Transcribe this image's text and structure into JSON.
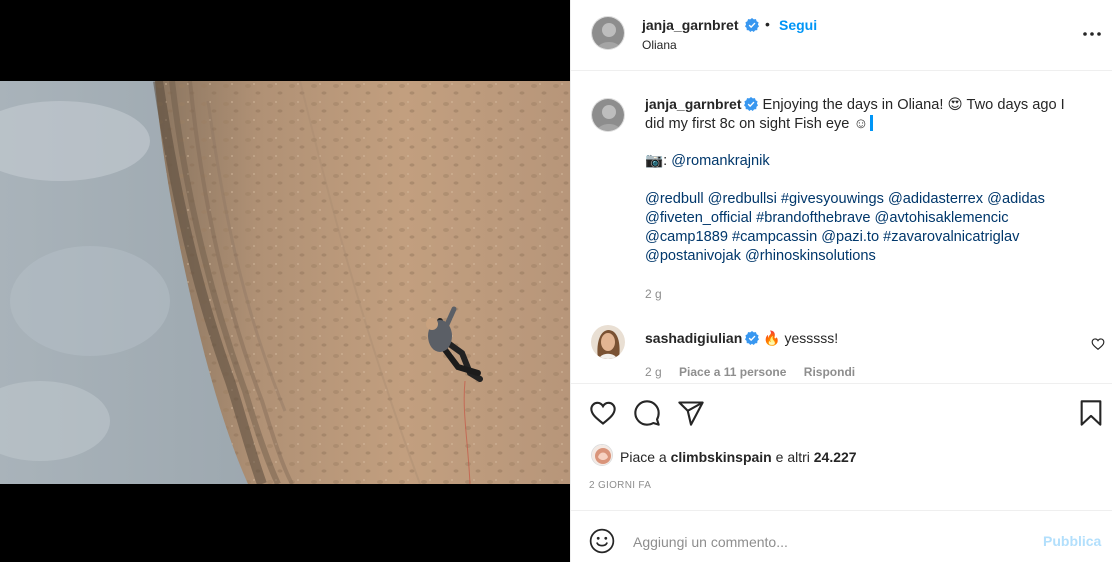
{
  "post": {
    "username": "janja_garnbret",
    "follow_label": "Segui",
    "dot": "•",
    "location": "Oliana"
  },
  "caption": {
    "username": "janja_garnbret",
    "line1": "Enjoying the days in Oliana! 😍 Two days ago I",
    "line2": "did my first 8c on sight Fish eye ☺",
    "photo_credit_icon": "📷",
    "photo_credit_sep": ":",
    "photo_credit": "@romankrajnik",
    "tags_line1": "@redbull @redbullsi #givesyouwings @adidasterrex @adidas",
    "tags_line2": "@fiveten_official #brandofthebrave @avtohisaklemencic",
    "tags_line3": "@camp1889 #campcassin @pazi.to #zavarovalnicatriglav",
    "tags_line4": "@postanivojak @rhinoskinsolutions",
    "time": "2 g"
  },
  "comment": {
    "username": "sashadigiulian",
    "text": "🔥 yesssss!",
    "time": "2 g",
    "likes": "Piace a 11 persone",
    "reply": "Rispondi"
  },
  "likes": {
    "prefix": "Piace a",
    "user": "climbskinspain",
    "middle": "e altri",
    "count": "24.227"
  },
  "posted_ago": "2 GIORNI FA",
  "add_comment": {
    "placeholder": "Aggiungi un commento...",
    "publish_label": "Pubblica"
  },
  "colors": {
    "accent": "#0095f6",
    "verified": "#3897f0",
    "publish_disabled": "#b2dffc",
    "link": "#00376b"
  }
}
